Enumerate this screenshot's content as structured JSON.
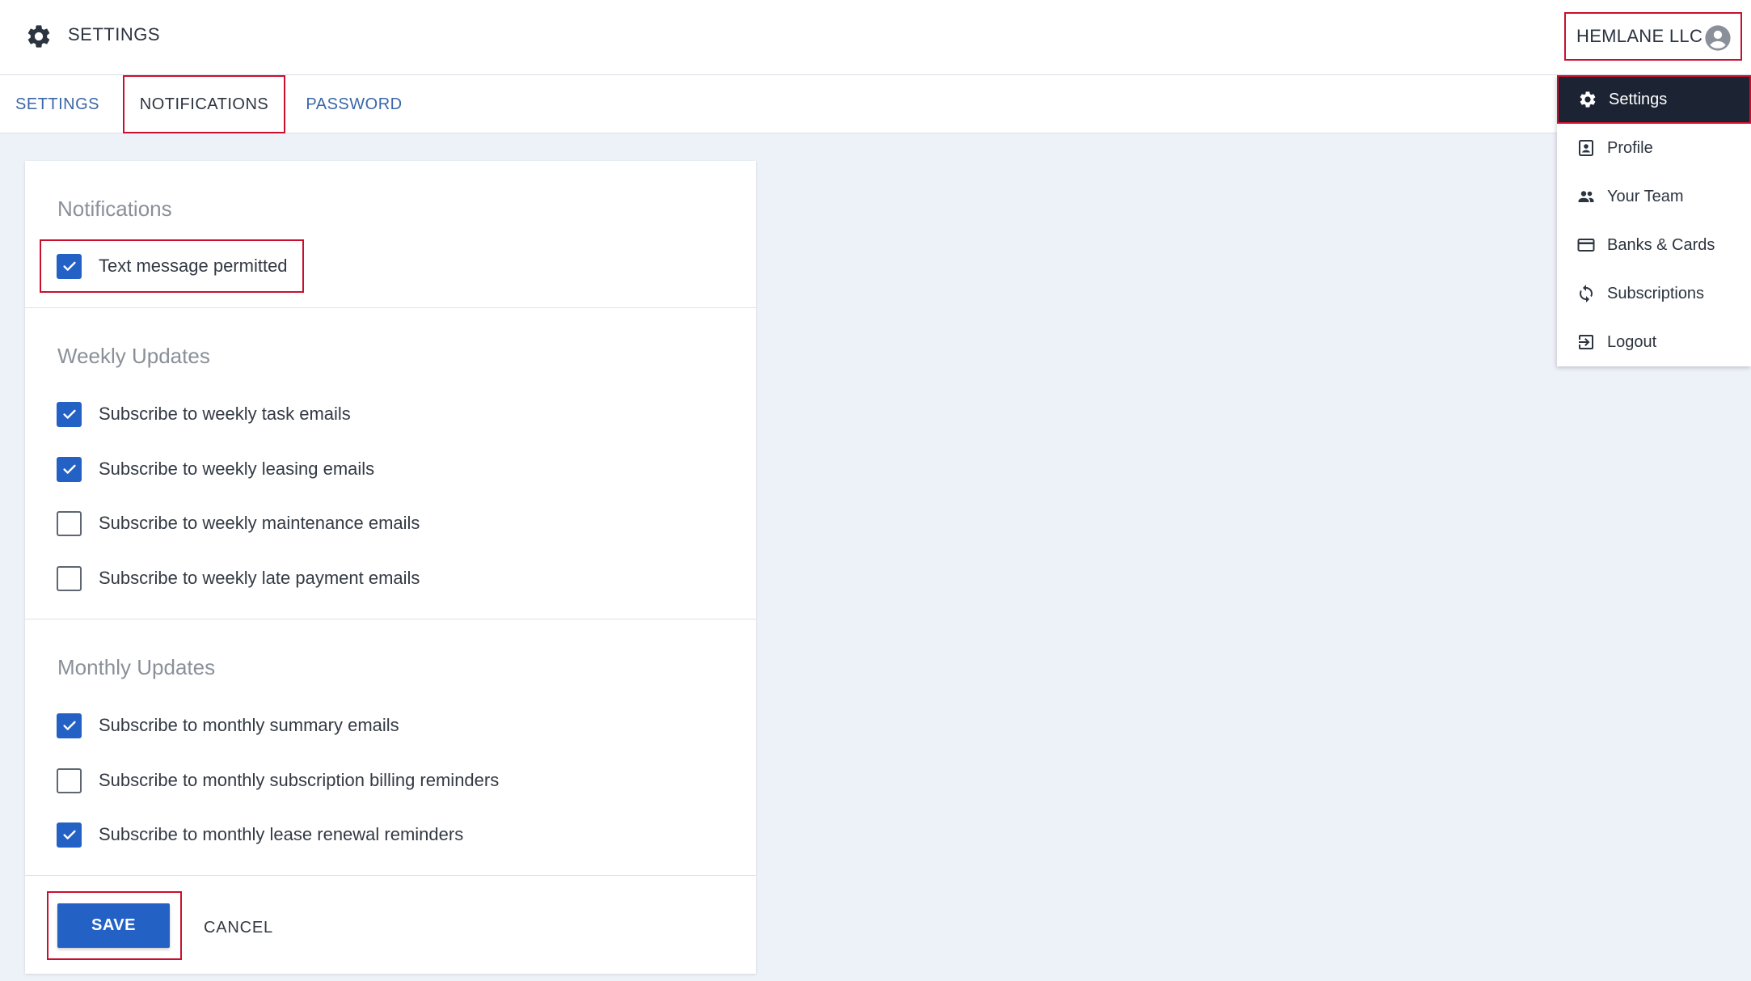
{
  "header": {
    "title": "SETTINGS",
    "account_name": "HEMLANE LLC"
  },
  "tabs": [
    {
      "label": "SETTINGS",
      "active": false
    },
    {
      "label": "NOTIFICATIONS",
      "active": true
    },
    {
      "label": "PASSWORD",
      "active": false
    }
  ],
  "notifications": {
    "title": "Notifications",
    "items": [
      {
        "label": "Text message permitted",
        "checked": true
      }
    ]
  },
  "weekly": {
    "title": "Weekly Updates",
    "items": [
      {
        "label": "Subscribe to weekly task emails",
        "checked": true
      },
      {
        "label": "Subscribe to weekly leasing emails",
        "checked": true
      },
      {
        "label": "Subscribe to weekly maintenance emails",
        "checked": false
      },
      {
        "label": "Subscribe to weekly late payment emails",
        "checked": false
      }
    ]
  },
  "monthly": {
    "title": "Monthly Updates",
    "items": [
      {
        "label": "Subscribe to monthly summary emails",
        "checked": true
      },
      {
        "label": "Subscribe to monthly subscription billing reminders",
        "checked": false
      },
      {
        "label": "Subscribe to monthly lease renewal reminders",
        "checked": true
      }
    ]
  },
  "actions": {
    "save_label": "SAVE",
    "cancel_label": "CANCEL"
  },
  "menu": {
    "items": [
      {
        "label": "Settings",
        "icon": "gear-icon",
        "active": true
      },
      {
        "label": "Profile",
        "icon": "profile-icon",
        "active": false
      },
      {
        "label": "Your Team",
        "icon": "team-icon",
        "active": false
      },
      {
        "label": "Banks & Cards",
        "icon": "credit-card-icon",
        "active": false
      },
      {
        "label": "Subscriptions",
        "icon": "sync-icon",
        "active": false
      },
      {
        "label": "Logout",
        "icon": "logout-icon",
        "active": false
      }
    ]
  },
  "colors": {
    "accent": "#2461c5",
    "highlight_border": "#c8102e",
    "menu_active_bg": "#1c2433",
    "page_bg": "#edf1f8"
  }
}
